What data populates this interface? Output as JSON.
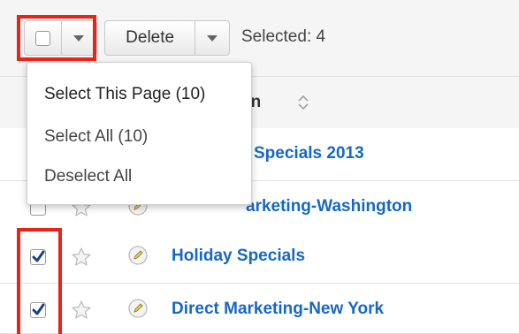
{
  "toolbar": {
    "delete_label": "Delete",
    "selected_text": "Selected: 4"
  },
  "header": {
    "column_partial_label": "gn"
  },
  "dropdown": {
    "items": [
      {
        "label": "Select This Page (10)"
      },
      {
        "label": "Select All (10)"
      },
      {
        "label": "Deselect All"
      }
    ]
  },
  "rows": [
    {
      "name": "Specials 2013",
      "checked": false,
      "partial": true
    },
    {
      "name": "arketing-Washington",
      "checked": false,
      "partial": true
    },
    {
      "name": "Holiday Specials",
      "checked": true,
      "partial": false
    },
    {
      "name": "Direct Marketing-New York",
      "checked": true,
      "partial": false
    }
  ],
  "colors": {
    "highlight": "#e8231a",
    "link": "#1668c7",
    "check": "#1b3f8b"
  }
}
